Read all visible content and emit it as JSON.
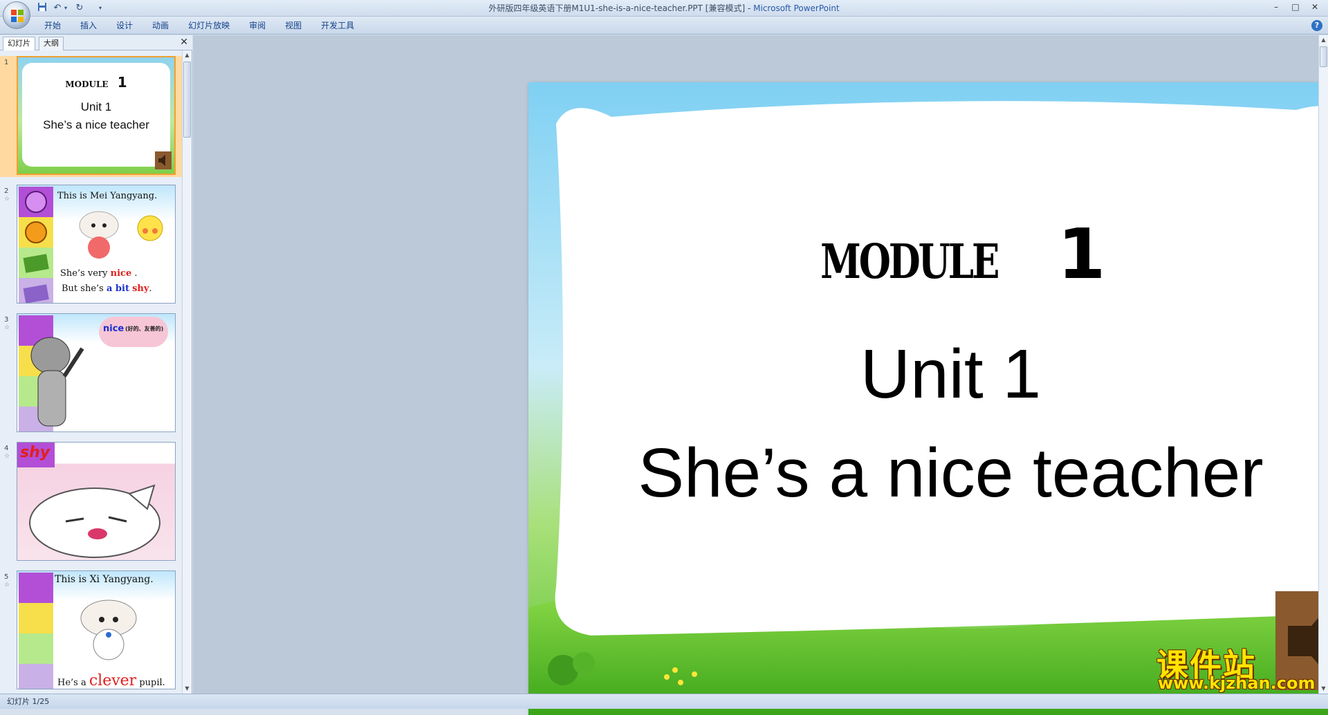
{
  "window": {
    "title_doc": "外研版四年级英语下册M1U1-she-is-a-nice-teacher.PPT [兼容模式]",
    "title_sep": " - ",
    "title_app": "Microsoft PowerPoint",
    "controls": [
      "–",
      "□",
      "✕"
    ]
  },
  "quick_access": {
    "icons": [
      "save-icon",
      "undo-icon",
      "redo-icon",
      "customize-icon"
    ]
  },
  "ribbon": {
    "tabs": [
      "开始",
      "插入",
      "设计",
      "动画",
      "幻灯片放映",
      "审阅",
      "视图",
      "开发工具"
    ]
  },
  "left_pane": {
    "tab_slides": "幻灯片",
    "tab_outline": "大纲",
    "close": "✕"
  },
  "thumbnails": [
    {
      "num": "1",
      "module": "MODULE",
      "module_num": "1",
      "unit": "Unit 1",
      "subtitle": "She’s a nice teacher"
    },
    {
      "num": "2",
      "line1": "This is Mei Yangyang.",
      "line2_a": "She’s  very ",
      "line2_b": "nice",
      "line2_c": " .",
      "line3_a": "But she’s ",
      "line3_b": "a bit",
      "line3_c": " ",
      "line3_d": "shy",
      "line3_e": "."
    },
    {
      "num": "3",
      "bubble_word": "nice",
      "bubble_note": "(好的、友善的)"
    },
    {
      "num": "4",
      "word": "shy"
    },
    {
      "num": "5",
      "line1": "This is Xi Yangyang.",
      "line2_a": "He’s a ",
      "line2_b": "clever",
      "line2_c": " pupil."
    }
  ],
  "slide": {
    "module_word": "MODULE",
    "module_num": "1",
    "unit": "Unit 1",
    "subtitle": "She’s a nice teacher"
  },
  "watermark": {
    "top": "课件站",
    "bottom": "www.kjzhan.com"
  },
  "statusbar": {
    "text": "幻灯片 1/25"
  },
  "colors": {
    "accent": "#15428b",
    "speaker": "#8a5a2e",
    "selected_thumb": "#f0a030"
  }
}
